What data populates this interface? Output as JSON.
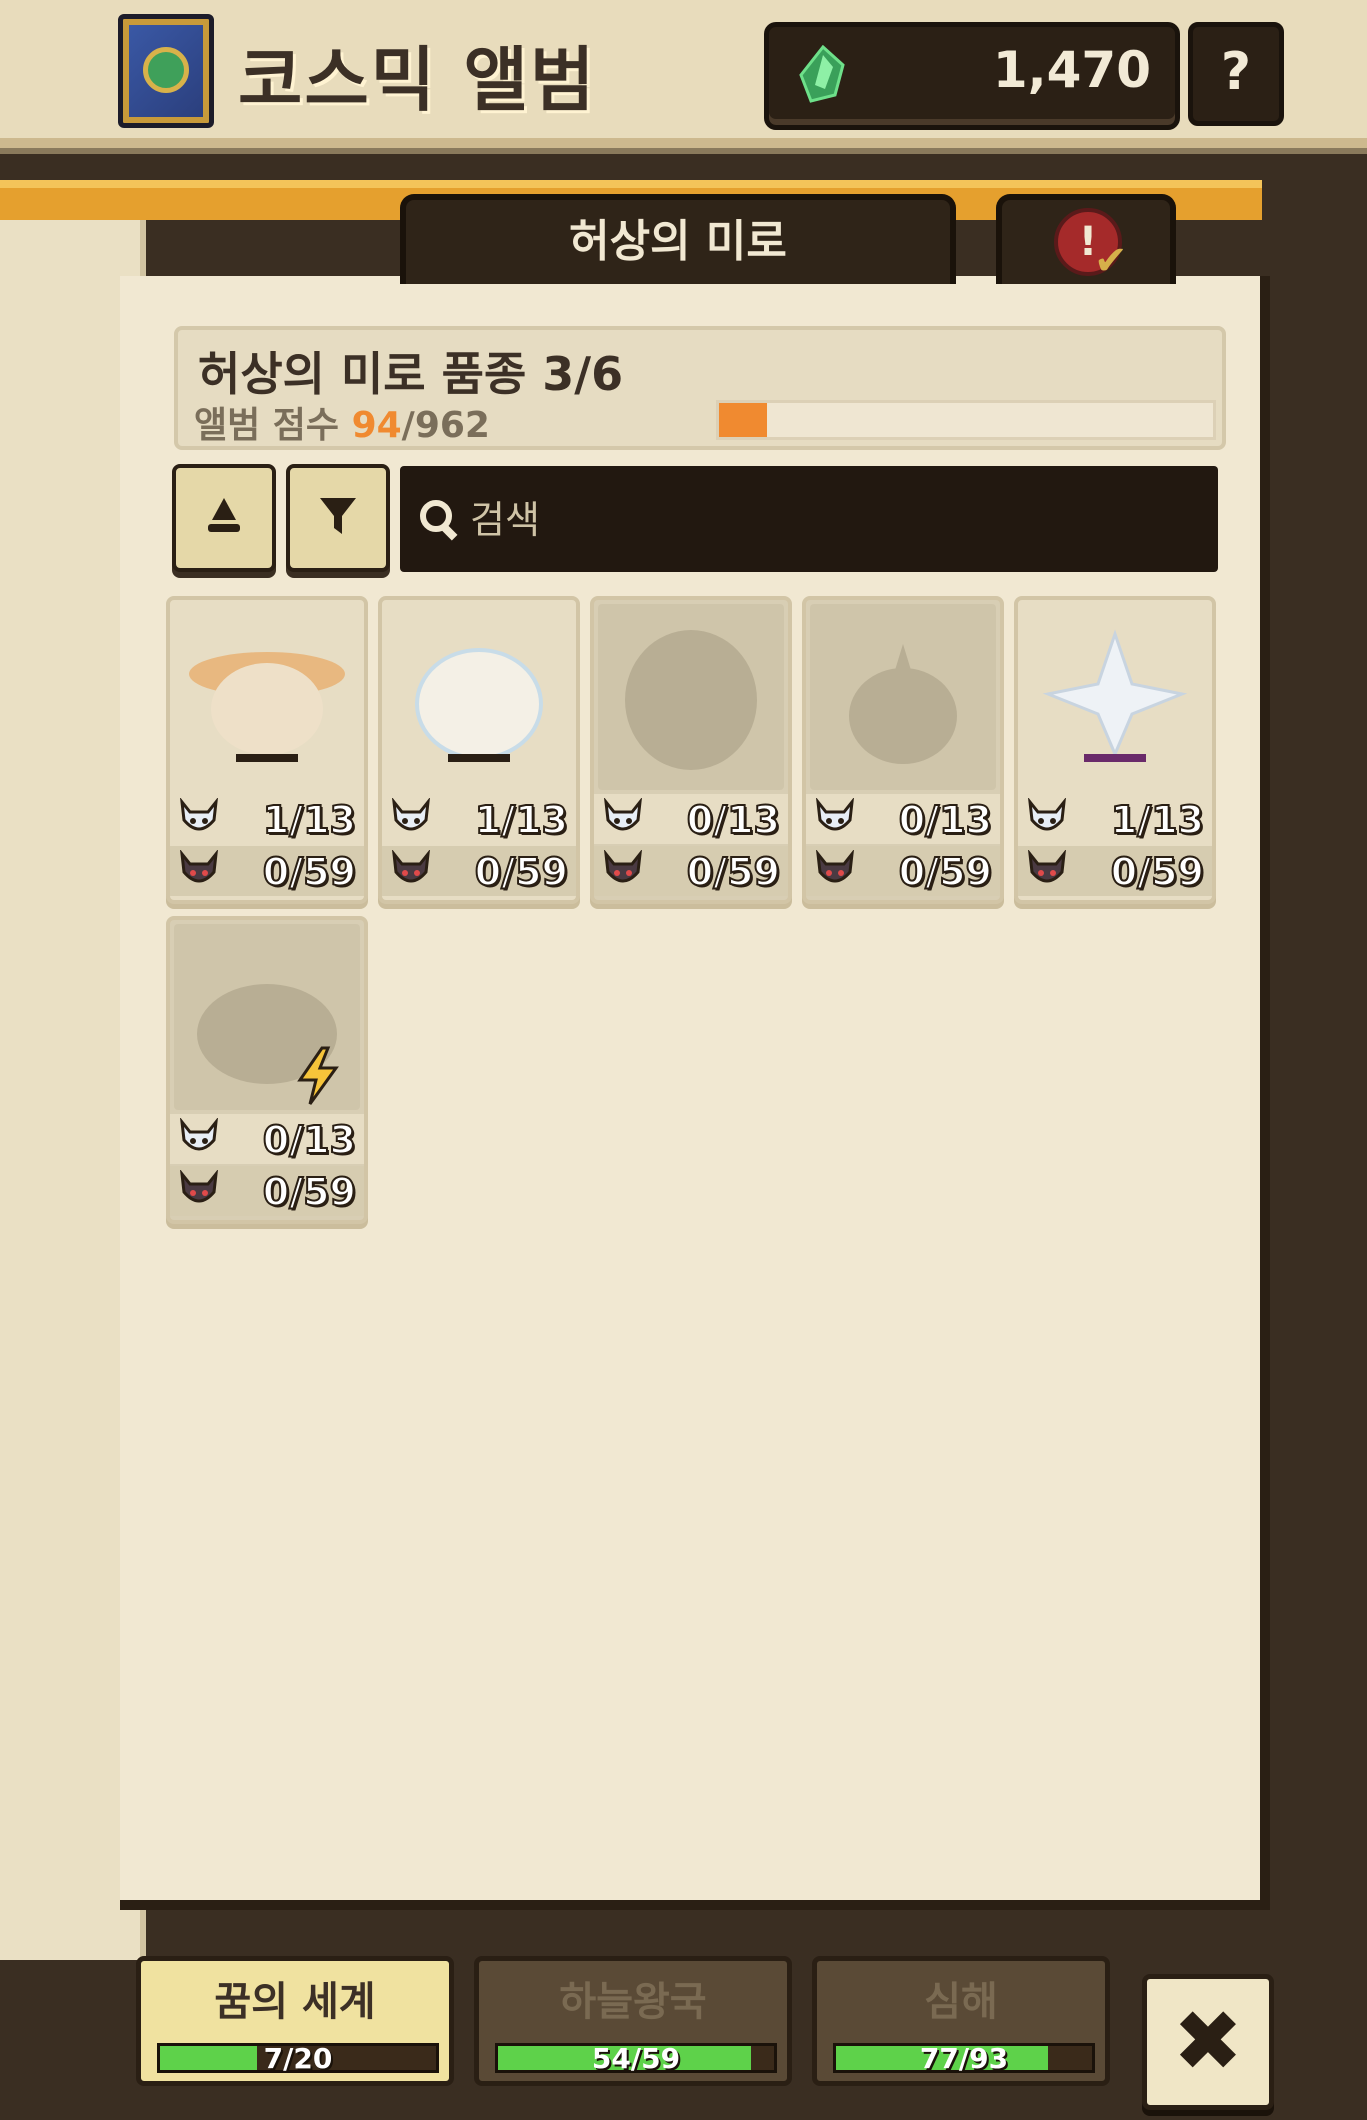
{
  "header": {
    "title": "코스믹 앨범",
    "currency": {
      "icon": "gem-icon",
      "value": "1,470"
    },
    "help_label": "?"
  },
  "tabs": {
    "main_label": "허상의 미로",
    "check_icon": "alert-check-icon",
    "alert_mark": "!"
  },
  "summary": {
    "title": "허상의 미로 품종 3/6",
    "score_label": "앨범 점수",
    "score_value": "94",
    "score_total": "/962",
    "progress": 0.098,
    "accent": "#f08a30"
  },
  "toolbar": {
    "sort_icon": "sort-icon",
    "filter_icon": "filter-icon",
    "search_placeholder": "검색"
  },
  "cards": [
    {
      "name": "card-1",
      "unlocked": true,
      "stat1": "1/13",
      "stat2": "0/59"
    },
    {
      "name": "card-2",
      "unlocked": true,
      "stat1": "1/13",
      "stat2": "0/59"
    },
    {
      "name": "card-3",
      "unlocked": false,
      "stat1": "0/13",
      "stat2": "0/59"
    },
    {
      "name": "card-4",
      "unlocked": false,
      "stat1": "0/13",
      "stat2": "0/59"
    },
    {
      "name": "card-5",
      "unlocked": true,
      "stat1": "1/13",
      "stat2": "0/59"
    },
    {
      "name": "card-6",
      "unlocked": false,
      "stat1": "0/13",
      "stat2": "0/59",
      "badge": "lightning-icon"
    }
  ],
  "regions": [
    {
      "label": "꿈의 세계",
      "count": "7/20",
      "progress": 0.35,
      "active": true
    },
    {
      "label": "하늘왕국",
      "count": "54/59",
      "progress": 0.915,
      "active": false
    },
    {
      "label": "심해",
      "count": "77/93",
      "progress": 0.83,
      "active": false
    }
  ],
  "close_label": "✖"
}
